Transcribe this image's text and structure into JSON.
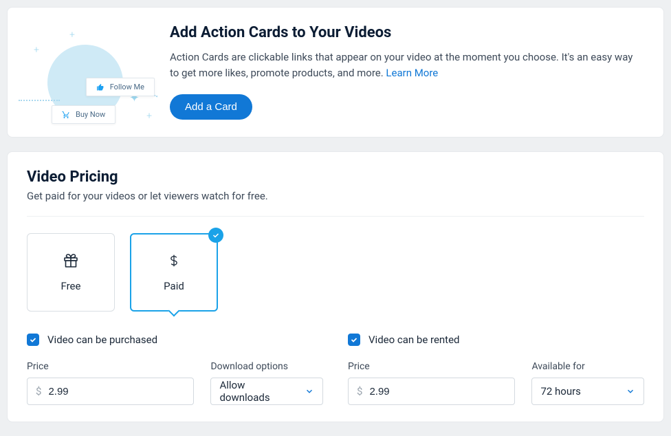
{
  "action_cards": {
    "title": "Add Action Cards to Your Videos",
    "description": "Action Cards are clickable links that appear on your video at the moment you choose. It's an easy way to get more likes, promote products, and more. ",
    "learn_more": "Learn More",
    "add_button": "Add a Card",
    "illustration": {
      "card1_label": "Follow Me",
      "card2_label": "Buy Now"
    }
  },
  "pricing": {
    "title": "Video Pricing",
    "subtitle": "Get paid for your videos or let viewers watch for free.",
    "options": {
      "free": "Free",
      "paid": "Paid"
    },
    "purchase": {
      "checkbox_label": "Video can be purchased",
      "price_label": "Price",
      "price_value": "2.99",
      "download_label": "Download options",
      "download_value": "Allow downloads"
    },
    "rent": {
      "checkbox_label": "Video can be rented",
      "price_label": "Price",
      "price_value": "2.99",
      "available_label": "Available for",
      "available_value": "72 hours"
    }
  }
}
